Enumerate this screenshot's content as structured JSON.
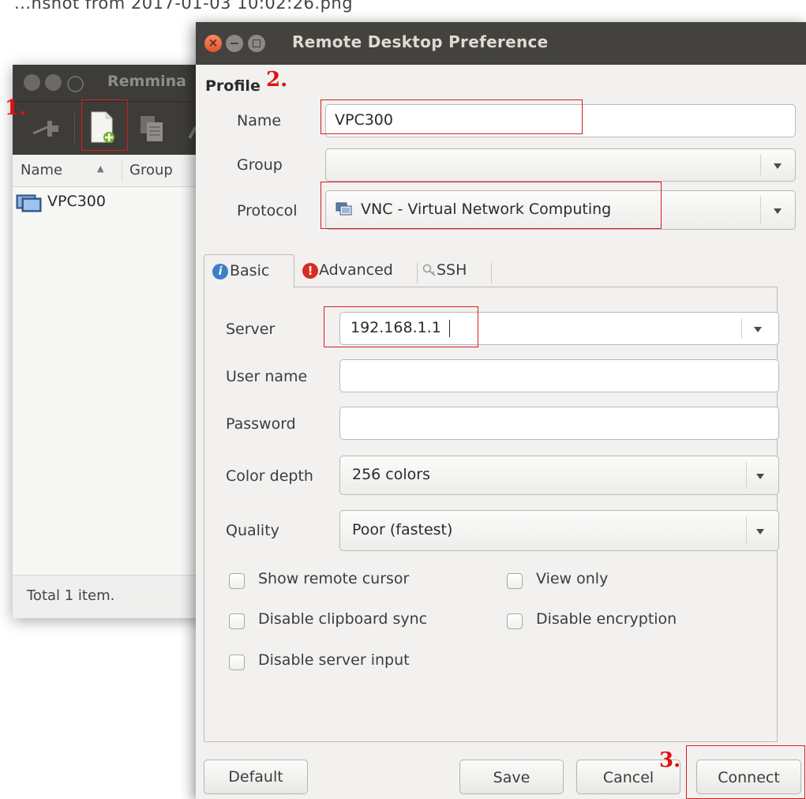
{
  "topline": "...nshot from 2017-01-03 10:02:26.png",
  "annotations": {
    "step1": "1.",
    "step2": "2.",
    "step3": "3."
  },
  "remmina": {
    "title": "Remmina",
    "columns": {
      "name": "Name",
      "group": "Group"
    },
    "rows": [
      {
        "name": "VPC300"
      }
    ],
    "status": "Total 1 item."
  },
  "dialog": {
    "title": "Remote Desktop Preference",
    "profile": {
      "heading": "Profile",
      "name_label": "Name",
      "name_value": "VPC300",
      "group_label": "Group",
      "group_value": "",
      "protocol_label": "Protocol",
      "protocol_value": "VNC - Virtual Network Computing"
    },
    "tabs": [
      {
        "label": "Basic",
        "icon": "info-icon",
        "active": true
      },
      {
        "label": "Advanced",
        "icon": "warning-icon",
        "active": false
      },
      {
        "label": "SSH",
        "icon": "ssh-key-icon",
        "active": false
      }
    ],
    "basic": {
      "server_label": "Server",
      "server_value": "192.168.1.1",
      "username_label": "User name",
      "username_value": "",
      "password_label": "Password",
      "password_value": "",
      "color_depth_label": "Color depth",
      "color_depth_value": "256 colors",
      "quality_label": "Quality",
      "quality_value": "Poor (fastest)",
      "checkboxes": {
        "show_remote_cursor": {
          "label": "Show remote cursor",
          "checked": false
        },
        "view_only": {
          "label": "View only",
          "checked": false
        },
        "disable_clipboard_sync": {
          "label": "Disable clipboard sync",
          "checked": false
        },
        "disable_encryption": {
          "label": "Disable encryption",
          "checked": false
        },
        "disable_server_input": {
          "label": "Disable server input",
          "checked": false
        }
      }
    },
    "buttons": {
      "default": "Default",
      "save": "Save",
      "cancel": "Cancel",
      "connect": "Connect"
    }
  },
  "colors": {
    "annotation_red": "#e01010",
    "titlebar": "#43423e",
    "close_orange": "#e2552b"
  }
}
